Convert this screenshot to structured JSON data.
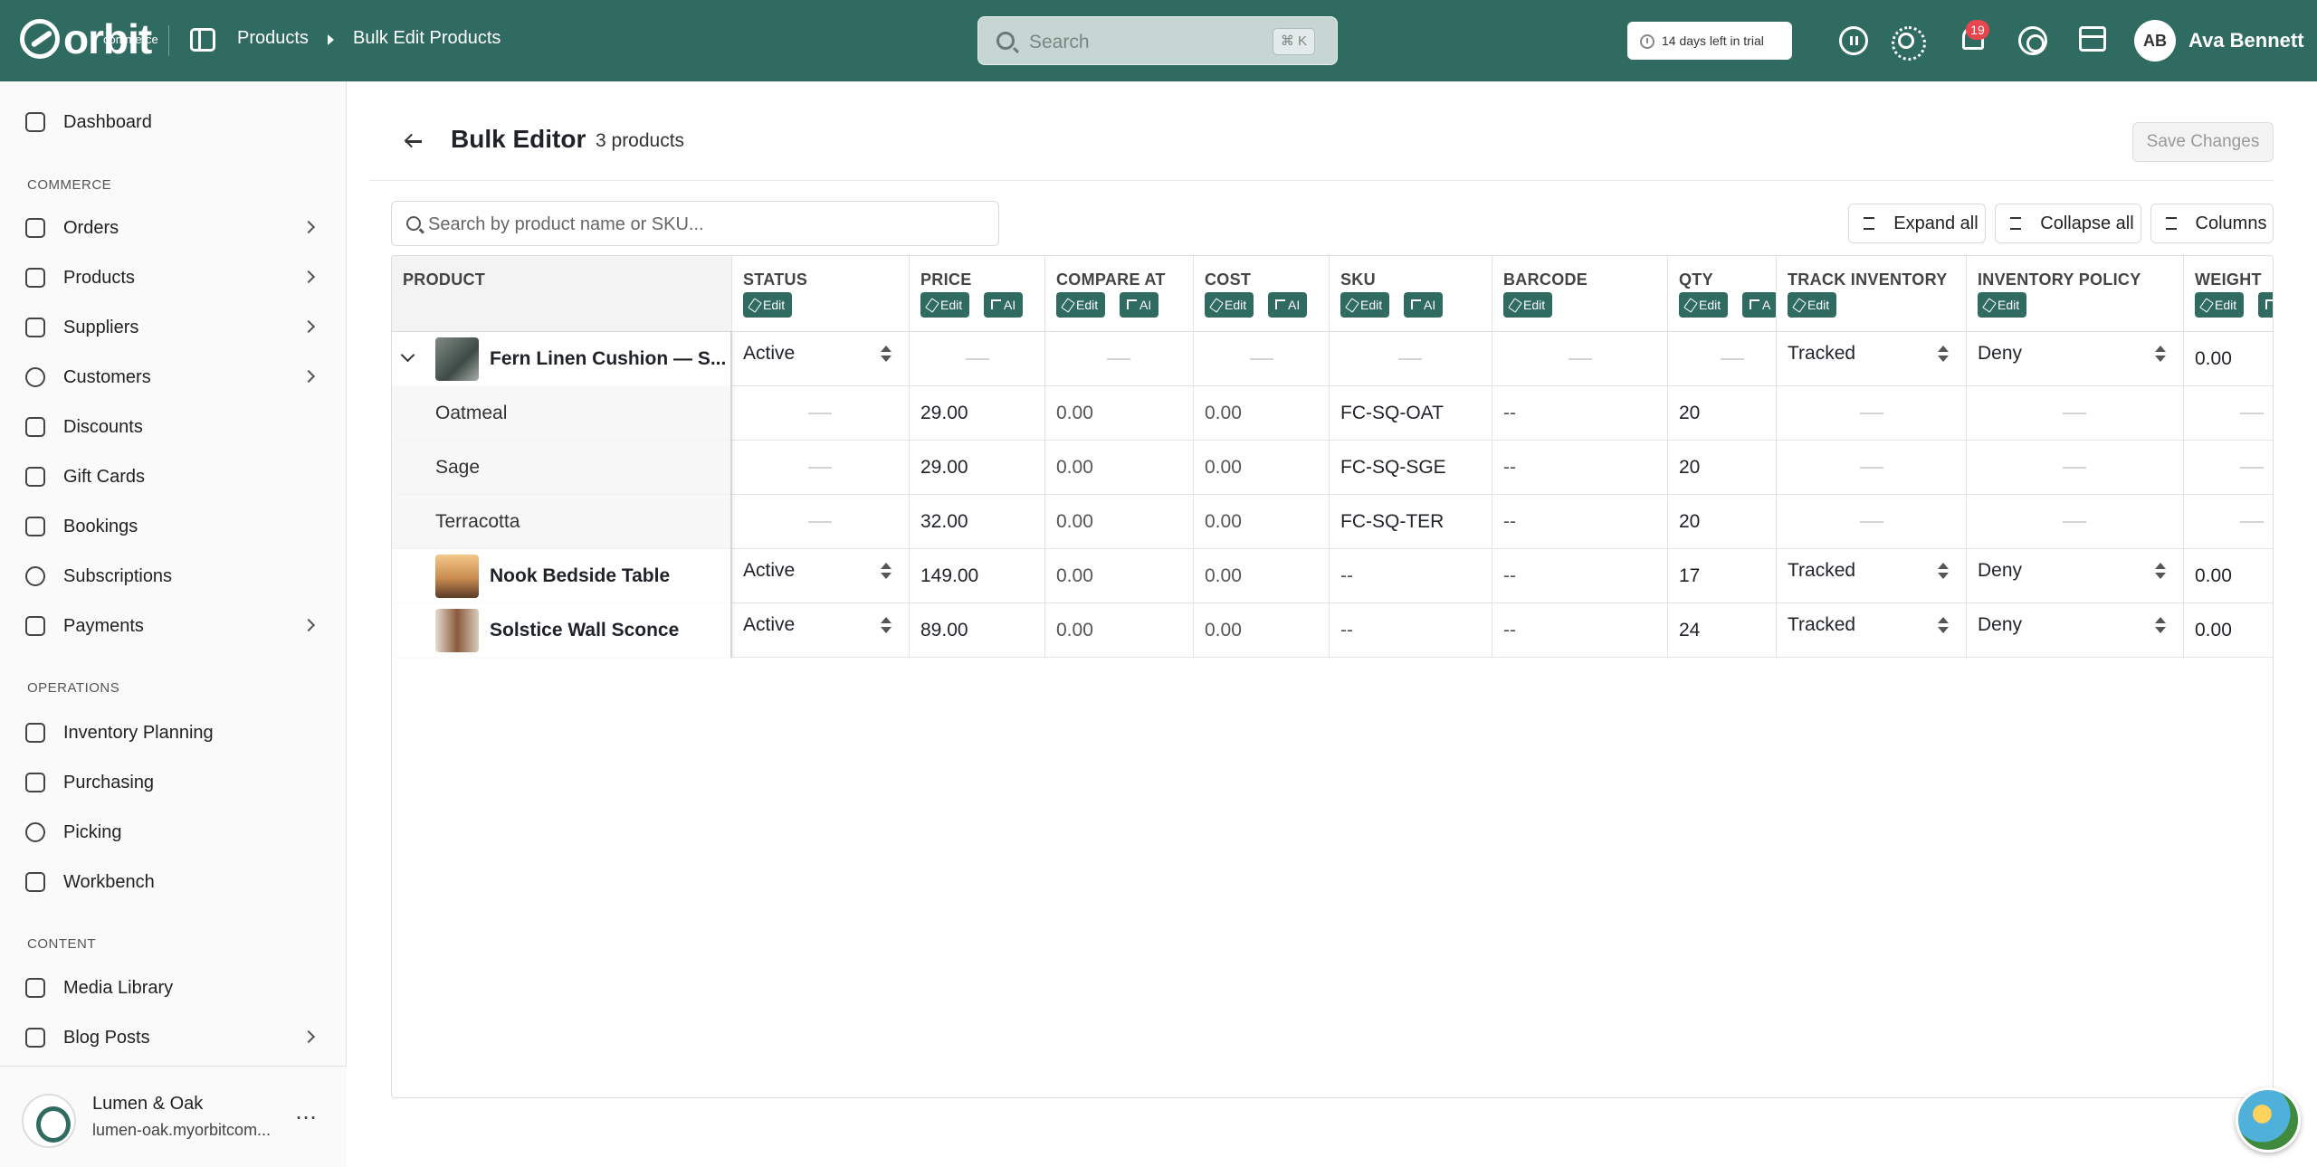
{
  "header": {
    "logo_text": "orbit",
    "logo_sub": "commerce",
    "breadcrumb": [
      "Products",
      "Bulk Edit Products"
    ],
    "search_placeholder": "Search",
    "search_shortcut": "⌘ K",
    "trial_text": "14 days left in trial",
    "notification_count": "19",
    "user_initials": "AB",
    "user_name": "Ava Bennett"
  },
  "sidebar": {
    "dashboard": "Dashboard",
    "section_commerce": "COMMERCE",
    "commerce_items": [
      "Orders",
      "Products",
      "Suppliers",
      "Customers",
      "Discounts",
      "Gift Cards",
      "Bookings",
      "Subscriptions",
      "Payments"
    ],
    "section_operations": "OPERATIONS",
    "operations_items": [
      "Inventory Planning",
      "Purchasing",
      "Picking",
      "Workbench"
    ],
    "section_content": "CONTENT",
    "content_items": [
      "Media Library",
      "Blog Posts"
    ],
    "store_name": "Lumen & Oak",
    "store_url": "lumen-oak.myorbitcom..."
  },
  "page": {
    "title": "Bulk Editor",
    "count": "3 products",
    "save_label": "Save Changes",
    "table_search_placeholder": "Search by product name or SKU...",
    "expand_all": "Expand all",
    "collapse_all": "Collapse all",
    "columns": "Columns"
  },
  "table": {
    "headers": [
      "PRODUCT",
      "STATUS",
      "PRICE",
      "COMPARE AT",
      "COST",
      "SKU",
      "BARCODE",
      "QTY",
      "TRACK INVENTORY",
      "INVENTORY POLICY",
      "WEIGHT"
    ],
    "edit_label": "Edit",
    "ai_label": "AI",
    "ai_label_truncated": "A",
    "products": [
      {
        "name": "Fern Linen Cushion — S...",
        "status": "Active",
        "track": "Tracked",
        "policy": "Deny",
        "weight": "0.00",
        "variants": [
          {
            "name": "Oatmeal",
            "price": "29.00",
            "compare": "0.00",
            "cost": "0.00",
            "sku": "FC-SQ-OAT",
            "barcode": "--",
            "qty": "20"
          },
          {
            "name": "Sage",
            "price": "29.00",
            "compare": "0.00",
            "cost": "0.00",
            "sku": "FC-SQ-SGE",
            "barcode": "--",
            "qty": "20"
          },
          {
            "name": "Terracotta",
            "price": "32.00",
            "compare": "0.00",
            "cost": "0.00",
            "sku": "FC-SQ-TER",
            "barcode": "--",
            "qty": "20"
          }
        ]
      },
      {
        "name": "Nook Bedside Table",
        "status": "Active",
        "price": "149.00",
        "compare": "0.00",
        "cost": "0.00",
        "sku": "--",
        "barcode": "--",
        "qty": "17",
        "track": "Tracked",
        "policy": "Deny",
        "weight": "0.00"
      },
      {
        "name": "Solstice Wall Sconce",
        "status": "Active",
        "price": "89.00",
        "compare": "0.00",
        "cost": "0.00",
        "sku": "--",
        "barcode": "--",
        "qty": "24",
        "track": "Tracked",
        "policy": "Deny",
        "weight": "0.00"
      }
    ]
  }
}
